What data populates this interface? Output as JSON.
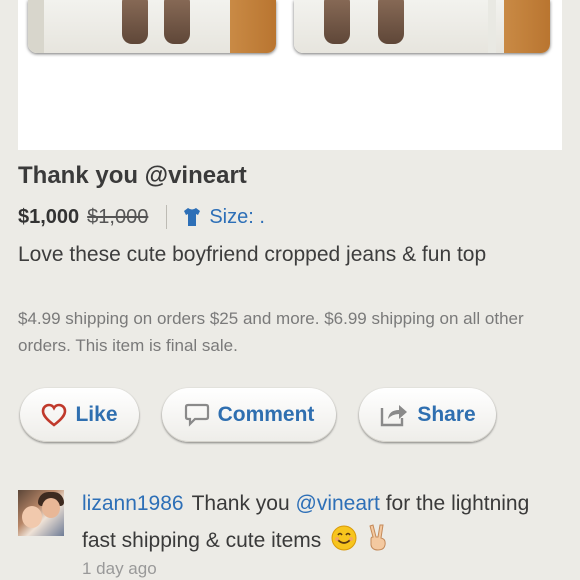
{
  "listing": {
    "title": "Thank you @vineart",
    "price": "$1,000",
    "original_price": "$1,000",
    "size_label": "Size: .",
    "description": "Love these cute boyfriend cropped jeans & fun top",
    "shipping": "$4.99 shipping on orders $25 and more. $6.99 shipping on all other orders. This item is final sale."
  },
  "actions": {
    "like_label": "Like",
    "comment_label": "Comment",
    "share_label": "Share"
  },
  "comment": {
    "username": "lizann1986",
    "text_before": "Thank you ",
    "mention": "@vineart",
    "text_after": " for the lightning fast shipping & cute items",
    "emojis": [
      "smile-emoji",
      "peace-hand-emoji"
    ],
    "timestamp": "1 day ago"
  },
  "colors": {
    "accent": "#2d6fb7",
    "like_heart": "#c0392b",
    "background": "#ecebe6"
  },
  "icons": [
    "heart-icon",
    "speech-bubble-icon",
    "share-arrow-icon",
    "shirt-icon"
  ]
}
